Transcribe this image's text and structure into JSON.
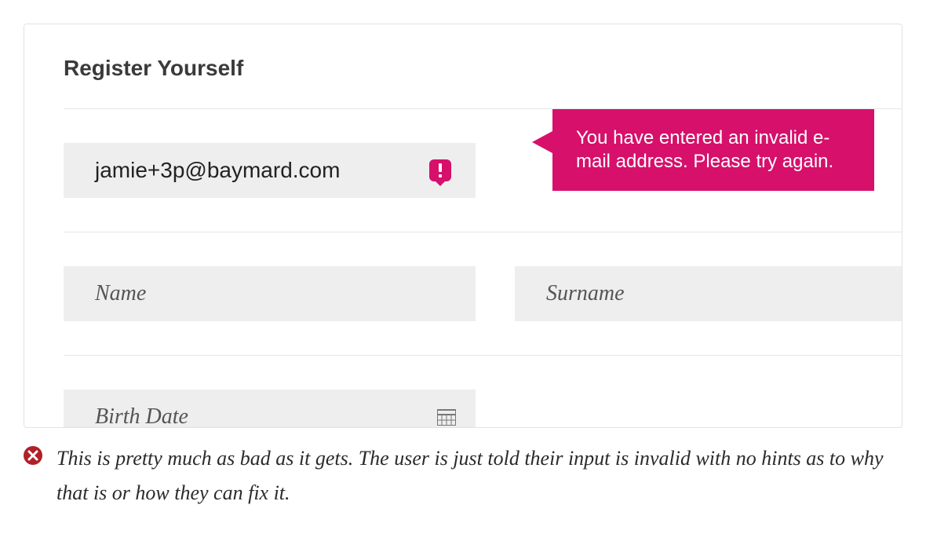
{
  "form": {
    "title": "Register Yourself",
    "email": {
      "value": "jamie+3p@baymard.com",
      "error_message": "You have entered an invalid e-mail address. Please try again."
    },
    "name_placeholder": "Name",
    "surname_placeholder": "Surname",
    "birth_date_placeholder": "Birth Date"
  },
  "caption": "This is pretty much as bad as it gets. The user is just told their input is invalid with no hints as to why that is or how they can fix it."
}
